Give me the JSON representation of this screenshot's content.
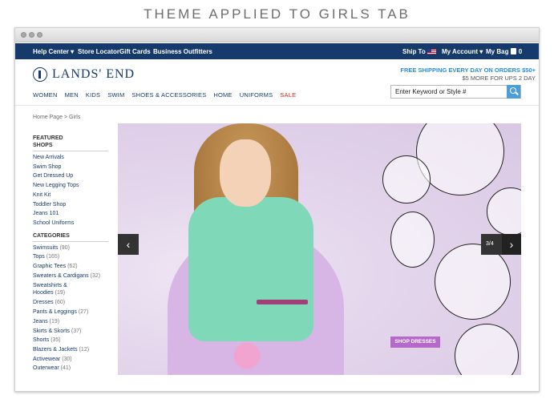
{
  "caption": "THEME APPLIED TO GIRLS TAB",
  "utility_bar": {
    "help_center": "Help Center ▾",
    "store_locator": "Store Locator",
    "gift_cards": "Gift Cards",
    "business_outfitters": "Business Outfitters",
    "ship_to": "Ship To",
    "my_account": "My Account ▾",
    "my_bag": "My Bag",
    "bag_count": "0"
  },
  "header": {
    "logo_text": "LANDS' END",
    "promo_line1": "FREE SHIPPING EVERY DAY ON ORDERS $50+",
    "promo_line2": "$5 MORE FOR UPS 2 DAY",
    "search_placeholder": "Enter Keyword or Style #"
  },
  "nav": [
    "WOMEN",
    "MEN",
    "KIDS",
    "SWIM",
    "SHOES & ACCESSORIES",
    "HOME",
    "UNIFORMS",
    "SALE"
  ],
  "breadcrumb": "Home Page  >  Girls",
  "sidebar": {
    "featured_heading_1": "FEATURED",
    "featured_heading_2": "SHOPS",
    "featured": [
      "New Arrivals",
      "Swim Shop",
      "Get Dressed Up",
      "New Legging Tops",
      "Knit Kit",
      "Toddler Shop",
      "Jeans 101",
      "School Uniforms"
    ],
    "categories_heading": "CATEGORIES",
    "categories": [
      {
        "label": "Swimsuits",
        "count": "(90)"
      },
      {
        "label": "Tops",
        "count": "(165)"
      },
      {
        "label": "Graphic Tees",
        "count": "(62)"
      },
      {
        "label": "Sweaters & Cardigans",
        "count": "(32)"
      },
      {
        "label": "Sweatshirts &",
        "count": ""
      },
      {
        "label": "Hoodies",
        "count": "(19)"
      },
      {
        "label": "Dresses",
        "count": "(60)"
      },
      {
        "label": "Pants & Leggings",
        "count": "(27)"
      },
      {
        "label": "Jeans",
        "count": "(19)"
      },
      {
        "label": "Skirts & Skorts",
        "count": "(37)"
      },
      {
        "label": "Shorts",
        "count": "(35)"
      },
      {
        "label": "Blazers & Jackets",
        "count": "(12)"
      },
      {
        "label": "Activewear",
        "count": "(30)"
      },
      {
        "label": "Outerwear",
        "count": "(41)"
      }
    ]
  },
  "hero": {
    "prev_icon": "‹",
    "next_icon": "›",
    "counter": "3/4",
    "shop_button": "SHOP DRESSES"
  }
}
